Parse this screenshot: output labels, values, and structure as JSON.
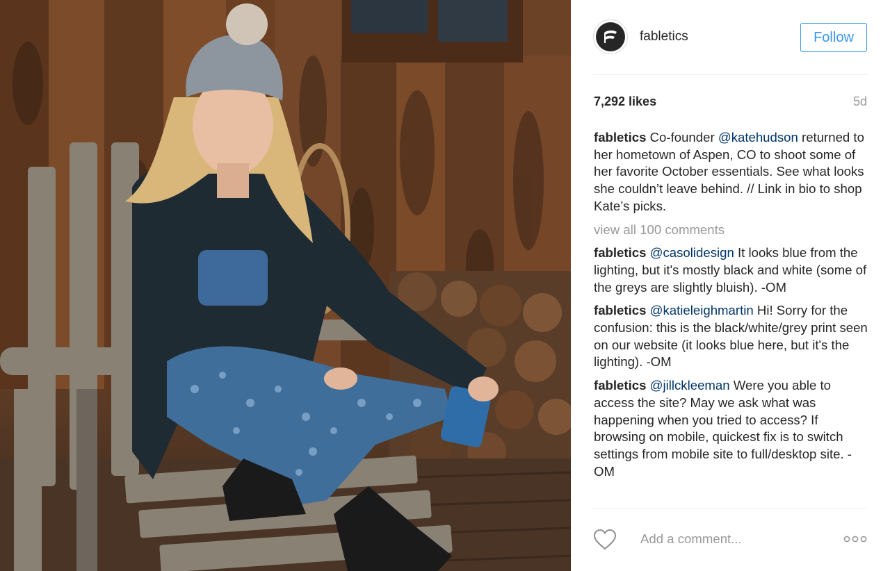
{
  "post": {
    "username": "fabletics",
    "follow_label": "Follow",
    "likes": "7,292 likes",
    "age": "5d",
    "caption": {
      "author": "fabletics",
      "pre": "Co-founder",
      "mention": "@katehudson",
      "text": "returned to her hometown of Aspen, CO to shoot some of her favorite October essentials. See what looks she couldn’t leave behind. // Link in bio to shop Kate’s picks."
    },
    "view_all_label": "view all 100 comments",
    "comments": [
      {
        "author": "fabletics",
        "mention": "@casolidesign",
        "text": "It looks blue from the lighting, but it's mostly black and white (some of the greys are slightly bluish). -OM"
      },
      {
        "author": "fabletics",
        "mention": "@katieleighmartin",
        "text": "Hi! Sorry for the confusion: this is the black/white/grey print seen on our website (it looks blue here, but it's the lighting). -OM"
      },
      {
        "author": "fabletics",
        "mention": "@jillckleeman",
        "text": "Were you able to access the site? May we ask what was happening when you tried to access? If browsing on mobile, quickest fix is to switch settings from mobile site to full/desktop site. -OM"
      }
    ],
    "add_comment_placeholder": "Add a comment...",
    "icons": {
      "heart": "heart-outline-icon",
      "more": "more-options-icon",
      "avatar": "fabletics-logo-icon"
    },
    "colors": {
      "accent": "#3897f0",
      "mention": "#003569",
      "muted": "#999999",
      "text": "#262626"
    }
  }
}
